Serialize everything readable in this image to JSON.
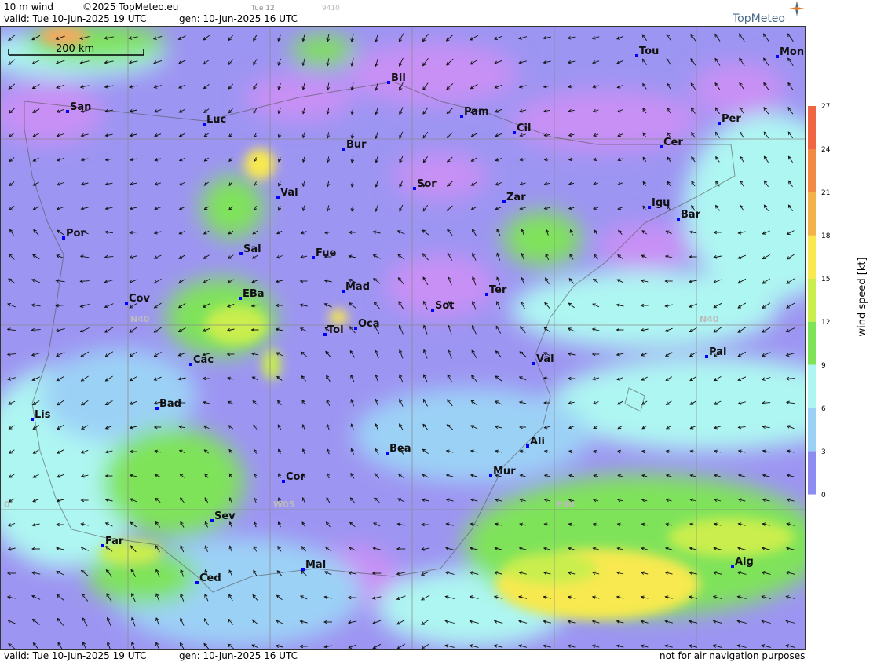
{
  "header": {
    "product": "10 m wind",
    "copyright": "©2025 TopMeteo.eu",
    "day_short": "Tue 12",
    "code": "9410",
    "valid": "valid:  Tue  10-Jun-2025  19 UTC",
    "gen": "gen: 10-Jun-2025 16 UTC",
    "logo": "TopMeteo"
  },
  "footer": {
    "valid": "valid:  Tue  10-Jun-2025  19 UTC",
    "gen": "gen: 10-Jun-2025 16 UTC",
    "disclaimer": "not for air navigation purposes"
  },
  "scale_bar": {
    "label": "200 km"
  },
  "grid_labels": {
    "n40": "N40",
    "n40_right": "N40",
    "w05": "W05",
    "e00": "E00",
    "w10": "0"
  },
  "legend": {
    "title": "wind speed  [kt]",
    "ticks": [
      "27",
      "24",
      "21",
      "18",
      "15",
      "12",
      "9",
      "6",
      "3",
      "0"
    ],
    "colors": [
      "#ee6644",
      "#f08a45",
      "#f3b24a",
      "#f7e94f",
      "#c9ee4e",
      "#7fe35a",
      "#aef6f2",
      "#9cd1f6",
      "#8d8cf3",
      "#c58cf6"
    ]
  },
  "cities": [
    {
      "name": "San"
    },
    {
      "name": "Luc"
    },
    {
      "name": "Bil"
    },
    {
      "name": "Pam"
    },
    {
      "name": "Tou"
    },
    {
      "name": "Mon"
    },
    {
      "name": "Per"
    },
    {
      "name": "Cil"
    },
    {
      "name": "Bur"
    },
    {
      "name": "Cer"
    },
    {
      "name": "Sor"
    },
    {
      "name": "Val"
    },
    {
      "name": "Zar"
    },
    {
      "name": "Igu"
    },
    {
      "name": "Bar"
    },
    {
      "name": "Por"
    },
    {
      "name": "Sal"
    },
    {
      "name": "Fue"
    },
    {
      "name": "Mad"
    },
    {
      "name": "Cov"
    },
    {
      "name": "EBa"
    },
    {
      "name": "Ter"
    },
    {
      "name": "Sot"
    },
    {
      "name": "Tol"
    },
    {
      "name": "Oca"
    },
    {
      "name": "Pal"
    },
    {
      "name": "Cac"
    },
    {
      "name": "Val"
    },
    {
      "name": "Bad"
    },
    {
      "name": "Lis"
    },
    {
      "name": "Ali"
    },
    {
      "name": "Bea"
    },
    {
      "name": "Mur"
    },
    {
      "name": "Cor"
    },
    {
      "name": "Sev"
    },
    {
      "name": "Far"
    },
    {
      "name": "Alg"
    },
    {
      "name": "Mal"
    },
    {
      "name": "Ced"
    }
  ]
}
